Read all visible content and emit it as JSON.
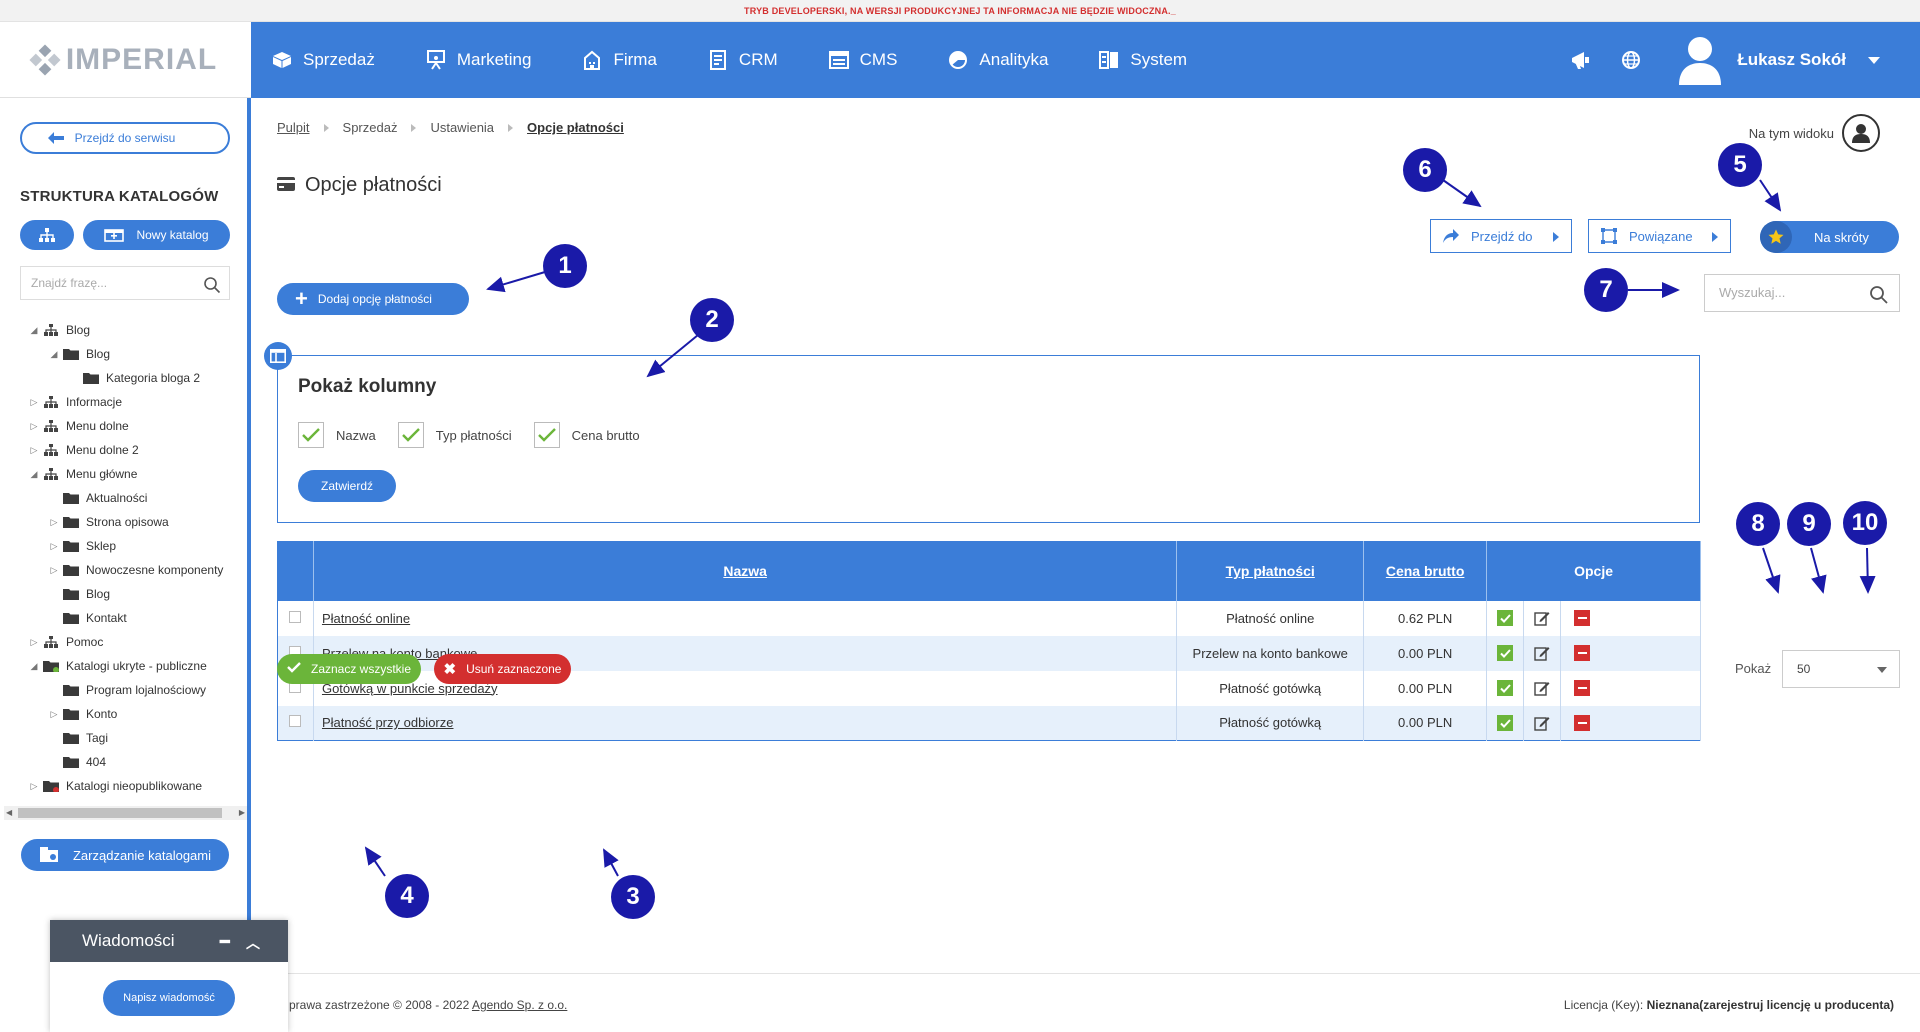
{
  "dev_banner": "TRYB DEVELOPERSKI, NA WERSJI PRODUKCYJNEJ TA INFORMACJA NIE BĘDZIE WIDOCZNA._",
  "logo": "IMPERIAL",
  "nav": {
    "items": [
      {
        "label": "Sprzedaż",
        "icon": "box-icon"
      },
      {
        "label": "Marketing",
        "icon": "presentation-icon"
      },
      {
        "label": "Firma",
        "icon": "building-icon"
      },
      {
        "label": "CRM",
        "icon": "address-book-icon"
      },
      {
        "label": "CMS",
        "icon": "window-icon"
      },
      {
        "label": "Analityka",
        "icon": "pie-chart-icon"
      },
      {
        "label": "System",
        "icon": "settings-panel-icon"
      }
    ],
    "user_name": "Łukasz Sokół"
  },
  "sidebar": {
    "goto_service": "Przejdź do serwisu",
    "title": "STRUKTURA KATALOGÓW",
    "new_catalog": "Nowy katalog",
    "search_placeholder": "Znajdź frazę...",
    "tree": [
      {
        "label": "Blog",
        "toggle": "◢",
        "type": "tree",
        "depth": 0
      },
      {
        "label": "Blog",
        "toggle": "◢",
        "type": "folder",
        "depth": 1
      },
      {
        "label": "Kategoria bloga 2",
        "toggle": "",
        "type": "folder",
        "depth": 2
      },
      {
        "label": "Informacje",
        "toggle": "▷",
        "type": "tree",
        "depth": 0
      },
      {
        "label": "Menu dolne",
        "toggle": "▷",
        "type": "tree",
        "depth": 0
      },
      {
        "label": "Menu dolne 2",
        "toggle": "▷",
        "type": "tree",
        "depth": 0
      },
      {
        "label": "Menu główne",
        "toggle": "◢",
        "type": "tree",
        "depth": 0
      },
      {
        "label": "Aktualności",
        "toggle": "",
        "type": "folder",
        "depth": 1
      },
      {
        "label": "Strona opisowa",
        "toggle": "▷",
        "type": "folder",
        "depth": 1
      },
      {
        "label": "Sklep",
        "toggle": "▷",
        "type": "folder",
        "depth": 1
      },
      {
        "label": "Nowoczesne komponenty",
        "toggle": "▷",
        "type": "folder",
        "depth": 1
      },
      {
        "label": "Blog",
        "toggle": "",
        "type": "folder",
        "depth": 1
      },
      {
        "label": "Kontakt",
        "toggle": "",
        "type": "folder",
        "depth": 1
      },
      {
        "label": "Pomoc",
        "toggle": "▷",
        "type": "tree",
        "depth": 0
      },
      {
        "label": "Katalogi ukryte - publiczne",
        "toggle": "◢",
        "type": "folder-green",
        "depth": 0
      },
      {
        "label": "Program lojalnościowy",
        "toggle": "",
        "type": "folder",
        "depth": 1
      },
      {
        "label": "Konto",
        "toggle": "▷",
        "type": "folder",
        "depth": 1
      },
      {
        "label": "Tagi",
        "toggle": "",
        "type": "folder",
        "depth": 1
      },
      {
        "label": "404",
        "toggle": "",
        "type": "folder",
        "depth": 1
      },
      {
        "label": "Katalogi nieopublikowane",
        "toggle": "▷",
        "type": "folder-red",
        "depth": 0
      }
    ],
    "manage_catalogs": "Zarządzanie katalogami"
  },
  "messages": {
    "title": "Wiadomości",
    "write": "Napisz wiadomość"
  },
  "breadcrumb": [
    {
      "label": "Pulpit",
      "link": true
    },
    {
      "label": "Sprzedaż",
      "link": false
    },
    {
      "label": "Ustawienia",
      "link": false
    },
    {
      "label": "Opcje płatności",
      "current": true
    }
  ],
  "view_label": "Na tym widoku",
  "page_title": "Opcje płatności",
  "buttons": {
    "goto": "Przejdź do",
    "related": "Powiązane",
    "shortcuts": "Na skróty",
    "add": "Dodaj opcję płatności",
    "confirm": "Zatwierdź",
    "select_all": "Zaznacz wszystkie",
    "delete_selected": "Usuń zaznaczone"
  },
  "search_placeholder": "Wyszukaj...",
  "columns_box": {
    "title": "Pokaż kolumny",
    "options": [
      {
        "label": "Nazwa",
        "checked": true
      },
      {
        "label": "Typ płatności",
        "checked": true
      },
      {
        "label": "Cena brutto",
        "checked": true
      }
    ]
  },
  "table": {
    "headers": [
      "Nazwa",
      "Typ płatności",
      "Cena brutto",
      "Opcje"
    ],
    "rows": [
      {
        "name": "Płatność online",
        "type": "Płatność online",
        "price": "0.62 PLN"
      },
      {
        "name": "Przelew na konto bankowe",
        "type": "Przelew na konto bankowe",
        "price": "0.00 PLN"
      },
      {
        "name": "Gotówką w punkcie sprzedaży",
        "type": "Płatność gotówką",
        "price": "0.00 PLN"
      },
      {
        "name": "Płatność przy odbiorze",
        "type": "Płatność gotówką",
        "price": "0.00 PLN"
      }
    ]
  },
  "pager": {
    "label": "Pokaż",
    "value": "50"
  },
  "footer": {
    "copyright": "prawa zastrzeżone © 2008 - 2022 ",
    "company": "Agendo Sp. z o.o.",
    "license_label": "Licencja (Key): ",
    "license_value": "Nieznana(zarejestruj licencję u producenta)"
  },
  "annotations": [
    "1",
    "2",
    "3",
    "4",
    "5",
    "6",
    "7",
    "8",
    "9",
    "10"
  ],
  "colors": {
    "primary": "#3b7dd8",
    "success": "#6bb53a",
    "danger": "#d32f2f",
    "annotation": "#1a1aa8"
  }
}
